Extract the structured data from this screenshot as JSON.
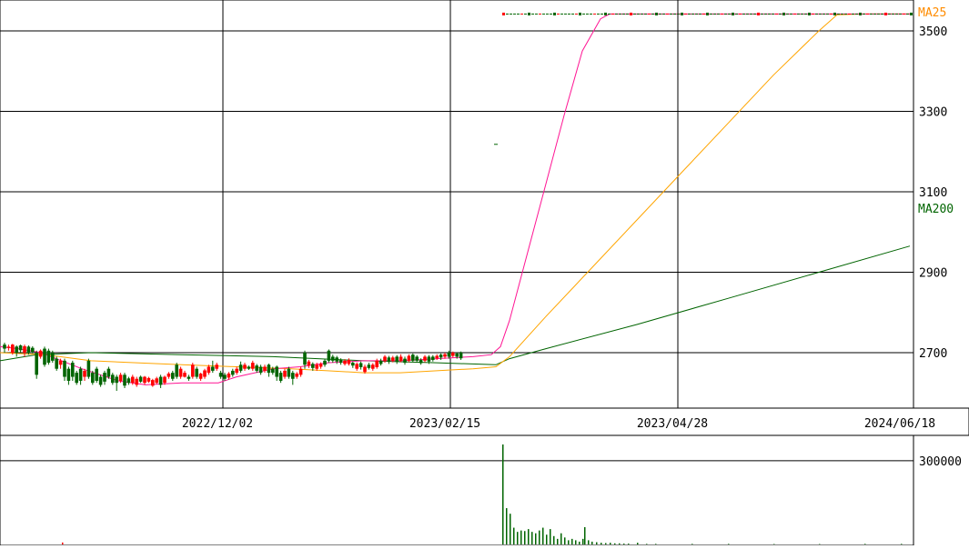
{
  "chart_data": {
    "type": "candlestick",
    "price_axis": {
      "ticks": [
        2700,
        2900,
        3100,
        3300,
        3500
      ],
      "tick_labels": [
        "2700",
        "2900",
        "3100",
        "3300",
        "3500"
      ],
      "ylim": [
        2560,
        3575
      ]
    },
    "date_axis": {
      "labels": [
        "2022/12/02",
        "2023/02/15",
        "2023/04/28",
        "2024/06/18"
      ]
    },
    "volume_axis": {
      "ticks": [
        300000
      ],
      "tick_labels": [
        "300000"
      ],
      "ylim": [
        0,
        358000
      ]
    },
    "legend": [
      {
        "name": "MA25",
        "color": "#ff8c00",
        "placement": "top-right"
      },
      {
        "name": "MA200",
        "color": "#006400",
        "placement": "right"
      }
    ],
    "colors": {
      "up": "#ff0000",
      "down": "#006400",
      "ma_short": "#ff1493",
      "ma25": "#ffa500",
      "ma200": "#006400",
      "volume": "#006400",
      "grid": "#000000"
    },
    "ma_short": [
      [
        0,
        2715
      ],
      [
        20,
        2710
      ],
      [
        45,
        2700
      ],
      [
        90,
        2660
      ],
      [
        130,
        2630
      ],
      [
        160,
        2620
      ],
      [
        200,
        2625
      ],
      [
        240,
        2625
      ],
      [
        260,
        2640
      ],
      [
        300,
        2660
      ],
      [
        330,
        2665
      ],
      [
        360,
        2675
      ],
      [
        400,
        2680
      ],
      [
        440,
        2680
      ],
      [
        480,
        2685
      ],
      [
        520,
        2690
      ],
      [
        540,
        2695
      ],
      [
        550,
        2715
      ],
      [
        560,
        2780
      ],
      [
        580,
        2950
      ],
      [
        600,
        3120
      ],
      [
        620,
        3290
      ],
      [
        640,
        3450
      ],
      [
        660,
        3530
      ],
      [
        670,
        3542
      ],
      [
        700,
        3542
      ],
      [
        800,
        3542
      ],
      [
        900,
        3542
      ],
      [
        1000,
        3542
      ]
    ],
    "ma25": [
      [
        0,
        2700
      ],
      [
        50,
        2695
      ],
      [
        100,
        2680
      ],
      [
        150,
        2675
      ],
      [
        200,
        2670
      ],
      [
        260,
        2665
      ],
      [
        320,
        2660
      ],
      [
        360,
        2655
      ],
      [
        400,
        2650
      ],
      [
        440,
        2650
      ],
      [
        480,
        2655
      ],
      [
        520,
        2660
      ],
      [
        545,
        2665
      ],
      [
        560,
        2690
      ],
      [
        600,
        2790
      ],
      [
        650,
        2910
      ],
      [
        700,
        3030
      ],
      [
        750,
        3150
      ],
      [
        800,
        3270
      ],
      [
        850,
        3390
      ],
      [
        900,
        3500
      ],
      [
        920,
        3540
      ],
      [
        950,
        3542
      ],
      [
        1000,
        3542
      ]
    ],
    "ma200": [
      [
        0,
        2680
      ],
      [
        40,
        2695
      ],
      [
        100,
        2700
      ],
      [
        200,
        2695
      ],
      [
        300,
        2690
      ],
      [
        400,
        2680
      ],
      [
        480,
        2675
      ],
      [
        545,
        2670
      ],
      [
        560,
        2685
      ],
      [
        600,
        2710
      ],
      [
        700,
        2770
      ],
      [
        800,
        2835
      ],
      [
        900,
        2900
      ],
      [
        1000,
        2965
      ]
    ],
    "candles": [
      {
        "o": 2720,
        "c": 2710,
        "h": 2725,
        "l": 2700
      },
      {
        "o": 2712,
        "c": 2715,
        "h": 2720,
        "l": 2705
      },
      {
        "o": 2700,
        "c": 2720,
        "h": 2722,
        "l": 2695
      },
      {
        "o": 2715,
        "c": 2700,
        "h": 2718,
        "l": 2690
      },
      {
        "o": 2718,
        "c": 2706,
        "h": 2720,
        "l": 2700
      },
      {
        "o": 2700,
        "c": 2716,
        "h": 2720,
        "l": 2690
      },
      {
        "o": 2715,
        "c": 2700,
        "h": 2718,
        "l": 2695
      },
      {
        "o": 2712,
        "c": 2702,
        "h": 2716,
        "l": 2698
      },
      {
        "o": 2700,
        "c": 2645,
        "h": 2705,
        "l": 2635
      },
      {
        "o": 2690,
        "c": 2705,
        "h": 2708,
        "l": 2685
      },
      {
        "o": 2710,
        "c": 2670,
        "h": 2715,
        "l": 2665
      },
      {
        "o": 2705,
        "c": 2675,
        "h": 2710,
        "l": 2670
      },
      {
        "o": 2700,
        "c": 2680,
        "h": 2705,
        "l": 2675
      },
      {
        "o": 2685,
        "c": 2660,
        "h": 2690,
        "l": 2655
      },
      {
        "o": 2670,
        "c": 2680,
        "h": 2685,
        "l": 2660
      },
      {
        "o": 2680,
        "c": 2640,
        "h": 2685,
        "l": 2630
      },
      {
        "o": 2660,
        "c": 2630,
        "h": 2665,
        "l": 2620
      },
      {
        "o": 2675,
        "c": 2640,
        "h": 2680,
        "l": 2630
      },
      {
        "o": 2650,
        "c": 2625,
        "h": 2655,
        "l": 2620
      },
      {
        "o": 2660,
        "c": 2630,
        "h": 2665,
        "l": 2620
      },
      {
        "o": 2640,
        "c": 2655,
        "h": 2660,
        "l": 2630
      },
      {
        "o": 2680,
        "c": 2640,
        "h": 2685,
        "l": 2635
      },
      {
        "o": 2650,
        "c": 2625,
        "h": 2655,
        "l": 2620
      },
      {
        "o": 2660,
        "c": 2630,
        "h": 2665,
        "l": 2625
      },
      {
        "o": 2640,
        "c": 2620,
        "h": 2645,
        "l": 2615
      },
      {
        "o": 2650,
        "c": 2628,
        "h": 2655,
        "l": 2620
      },
      {
        "o": 2660,
        "c": 2640,
        "h": 2665,
        "l": 2635
      },
      {
        "o": 2645,
        "c": 2625,
        "h": 2650,
        "l": 2620
      },
      {
        "o": 2640,
        "c": 2625,
        "h": 2645,
        "l": 2605
      },
      {
        "o": 2630,
        "c": 2645,
        "h": 2650,
        "l": 2625
      },
      {
        "o": 2645,
        "c": 2618,
        "h": 2650,
        "l": 2612
      },
      {
        "o": 2636,
        "c": 2625,
        "h": 2640,
        "l": 2620
      },
      {
        "o": 2625,
        "c": 2640,
        "h": 2645,
        "l": 2620
      },
      {
        "o": 2620,
        "c": 2635,
        "h": 2640,
        "l": 2615
      },
      {
        "o": 2640,
        "c": 2628,
        "h": 2643,
        "l": 2625
      },
      {
        "o": 2625,
        "c": 2640,
        "h": 2642,
        "l": 2620
      },
      {
        "o": 2628,
        "c": 2637,
        "h": 2640,
        "l": 2625
      },
      {
        "o": 2618,
        "c": 2632,
        "h": 2635,
        "l": 2615
      },
      {
        "o": 2625,
        "c": 2636,
        "h": 2640,
        "l": 2622
      },
      {
        "o": 2640,
        "c": 2620,
        "h": 2645,
        "l": 2612
      },
      {
        "o": 2625,
        "c": 2640,
        "h": 2643,
        "l": 2620
      },
      {
        "o": 2640,
        "c": 2648,
        "h": 2652,
        "l": 2635
      },
      {
        "o": 2650,
        "c": 2635,
        "h": 2655,
        "l": 2630
      },
      {
        "o": 2670,
        "c": 2640,
        "h": 2675,
        "l": 2635
      },
      {
        "o": 2640,
        "c": 2660,
        "h": 2665,
        "l": 2635
      },
      {
        "o": 2640,
        "c": 2650,
        "h": 2655,
        "l": 2638
      },
      {
        "o": 2640,
        "c": 2635,
        "h": 2645,
        "l": 2630
      },
      {
        "o": 2640,
        "c": 2670,
        "h": 2675,
        "l": 2635
      },
      {
        "o": 2660,
        "c": 2640,
        "h": 2665,
        "l": 2635
      },
      {
        "o": 2635,
        "c": 2648,
        "h": 2650,
        "l": 2630
      },
      {
        "o": 2640,
        "c": 2656,
        "h": 2660,
        "l": 2635
      },
      {
        "o": 2650,
        "c": 2665,
        "h": 2670,
        "l": 2645
      },
      {
        "o": 2665,
        "c": 2655,
        "h": 2680,
        "l": 2650
      },
      {
        "o": 2660,
        "c": 2670,
        "h": 2675,
        "l": 2655
      },
      {
        "o": 2650,
        "c": 2640,
        "h": 2655,
        "l": 2635
      },
      {
        "o": 2645,
        "c": 2635,
        "h": 2650,
        "l": 2630
      },
      {
        "o": 2638,
        "c": 2648,
        "h": 2652,
        "l": 2633
      },
      {
        "o": 2655,
        "c": 2645,
        "h": 2660,
        "l": 2640
      },
      {
        "o": 2650,
        "c": 2660,
        "h": 2665,
        "l": 2645
      },
      {
        "o": 2670,
        "c": 2655,
        "h": 2678,
        "l": 2650
      },
      {
        "o": 2660,
        "c": 2670,
        "h": 2675,
        "l": 2655
      },
      {
        "o": 2665,
        "c": 2660,
        "h": 2668,
        "l": 2657
      },
      {
        "o": 2660,
        "c": 2675,
        "h": 2680,
        "l": 2655
      },
      {
        "o": 2668,
        "c": 2655,
        "h": 2672,
        "l": 2650
      },
      {
        "o": 2665,
        "c": 2650,
        "h": 2670,
        "l": 2645
      },
      {
        "o": 2655,
        "c": 2665,
        "h": 2670,
        "l": 2650
      },
      {
        "o": 2670,
        "c": 2650,
        "h": 2673,
        "l": 2640
      },
      {
        "o": 2660,
        "c": 2650,
        "h": 2665,
        "l": 2645
      },
      {
        "o": 2665,
        "c": 2640,
        "h": 2668,
        "l": 2630
      },
      {
        "o": 2650,
        "c": 2630,
        "h": 2655,
        "l": 2625
      },
      {
        "o": 2640,
        "c": 2655,
        "h": 2660,
        "l": 2635
      },
      {
        "o": 2660,
        "c": 2640,
        "h": 2665,
        "l": 2635
      },
      {
        "o": 2650,
        "c": 2635,
        "h": 2655,
        "l": 2620
      },
      {
        "o": 2640,
        "c": 2648,
        "h": 2652,
        "l": 2635
      },
      {
        "o": 2645,
        "c": 2660,
        "h": 2665,
        "l": 2640
      },
      {
        "o": 2700,
        "c": 2670,
        "h": 2705,
        "l": 2660
      },
      {
        "o": 2668,
        "c": 2678,
        "h": 2682,
        "l": 2662
      },
      {
        "o": 2672,
        "c": 2662,
        "h": 2676,
        "l": 2655
      },
      {
        "o": 2660,
        "c": 2670,
        "h": 2675,
        "l": 2655
      },
      {
        "o": 2665,
        "c": 2672,
        "h": 2676,
        "l": 2660
      },
      {
        "o": 2680,
        "c": 2670,
        "h": 2685,
        "l": 2665
      },
      {
        "o": 2705,
        "c": 2680,
        "h": 2708,
        "l": 2675
      },
      {
        "o": 2690,
        "c": 2680,
        "h": 2695,
        "l": 2675
      },
      {
        "o": 2688,
        "c": 2678,
        "h": 2692,
        "l": 2672
      },
      {
        "o": 2682,
        "c": 2675,
        "h": 2686,
        "l": 2670
      },
      {
        "o": 2672,
        "c": 2680,
        "h": 2684,
        "l": 2668
      },
      {
        "o": 2672,
        "c": 2682,
        "h": 2686,
        "l": 2668
      },
      {
        "o": 2675,
        "c": 2668,
        "h": 2678,
        "l": 2662
      },
      {
        "o": 2660,
        "c": 2672,
        "h": 2676,
        "l": 2655
      },
      {
        "o": 2674,
        "c": 2664,
        "h": 2678,
        "l": 2658
      },
      {
        "o": 2652,
        "c": 2665,
        "h": 2670,
        "l": 2648
      },
      {
        "o": 2670,
        "c": 2662,
        "h": 2675,
        "l": 2658
      },
      {
        "o": 2660,
        "c": 2670,
        "h": 2674,
        "l": 2655
      },
      {
        "o": 2664,
        "c": 2680,
        "h": 2685,
        "l": 2660
      },
      {
        "o": 2680,
        "c": 2672,
        "h": 2685,
        "l": 2668
      },
      {
        "o": 2680,
        "c": 2690,
        "h": 2694,
        "l": 2675
      },
      {
        "o": 2688,
        "c": 2678,
        "h": 2692,
        "l": 2672
      },
      {
        "o": 2680,
        "c": 2688,
        "h": 2692,
        "l": 2676
      },
      {
        "o": 2690,
        "c": 2678,
        "h": 2694,
        "l": 2672
      },
      {
        "o": 2680,
        "c": 2690,
        "h": 2696,
        "l": 2676
      },
      {
        "o": 2685,
        "c": 2675,
        "h": 2690,
        "l": 2670
      },
      {
        "o": 2680,
        "c": 2692,
        "h": 2696,
        "l": 2676
      },
      {
        "o": 2695,
        "c": 2680,
        "h": 2698,
        "l": 2676
      },
      {
        "o": 2690,
        "c": 2680,
        "h": 2694,
        "l": 2676
      },
      {
        "o": 2682,
        "c": 2674,
        "h": 2686,
        "l": 2670
      },
      {
        "o": 2680,
        "c": 2690,
        "h": 2694,
        "l": 2676
      },
      {
        "o": 2690,
        "c": 2678,
        "h": 2694,
        "l": 2672
      },
      {
        "o": 2690,
        "c": 2682,
        "h": 2694,
        "l": 2678
      },
      {
        "o": 2686,
        "c": 2692,
        "h": 2696,
        "l": 2682
      },
      {
        "o": 2695,
        "c": 2688,
        "h": 2698,
        "l": 2682
      },
      {
        "o": 2690,
        "c": 2696,
        "h": 2700,
        "l": 2685
      },
      {
        "o": 2700,
        "c": 2690,
        "h": 2705,
        "l": 2685
      },
      {
        "o": 2692,
        "c": 2700,
        "h": 2703,
        "l": 2688
      },
      {
        "o": 2698,
        "c": 2690,
        "h": 2700,
        "l": 2685
      },
      {
        "o": 2700,
        "c": 2686,
        "h": 2703,
        "l": 2682
      }
    ],
    "candle_x_start": 5,
    "candle_x_step": 4.4,
    "outlier_ticks": [
      [
        545,
        3218
      ]
    ],
    "top_candles_x_range": [
      552,
      1000
    ],
    "top_candles_level": 3542,
    "volume_bars": [
      [
        552,
        358000
      ],
      [
        556,
        130000
      ],
      [
        560,
        110000
      ],
      [
        564,
        60000
      ],
      [
        568,
        45000
      ],
      [
        572,
        50000
      ],
      [
        576,
        48000
      ],
      [
        580,
        55000
      ],
      [
        584,
        45000
      ],
      [
        588,
        40000
      ],
      [
        592,
        50000
      ],
      [
        596,
        60000
      ],
      [
        600,
        35000
      ],
      [
        604,
        55000
      ],
      [
        608,
        30000
      ],
      [
        612,
        20000
      ],
      [
        616,
        40000
      ],
      [
        620,
        25000
      ],
      [
        624,
        15000
      ],
      [
        628,
        20000
      ],
      [
        632,
        15000
      ],
      [
        636,
        10000
      ],
      [
        640,
        20000
      ],
      [
        642,
        62000
      ],
      [
        646,
        15000
      ],
      [
        650,
        10000
      ],
      [
        655,
        8000
      ],
      [
        660,
        6000
      ],
      [
        665,
        5000
      ],
      [
        670,
        6000
      ],
      [
        675,
        4000
      ],
      [
        680,
        4000
      ],
      [
        685,
        3000
      ],
      [
        690,
        3000
      ],
      [
        700,
        6000
      ],
      [
        710,
        2000
      ],
      [
        720,
        2000
      ],
      [
        760,
        2000
      ],
      [
        800,
        2000
      ],
      [
        850,
        1500
      ],
      [
        900,
        1500
      ],
      [
        950,
        2000
      ],
      [
        990,
        2000
      ],
      [
        68,
        7000
      ]
    ]
  }
}
